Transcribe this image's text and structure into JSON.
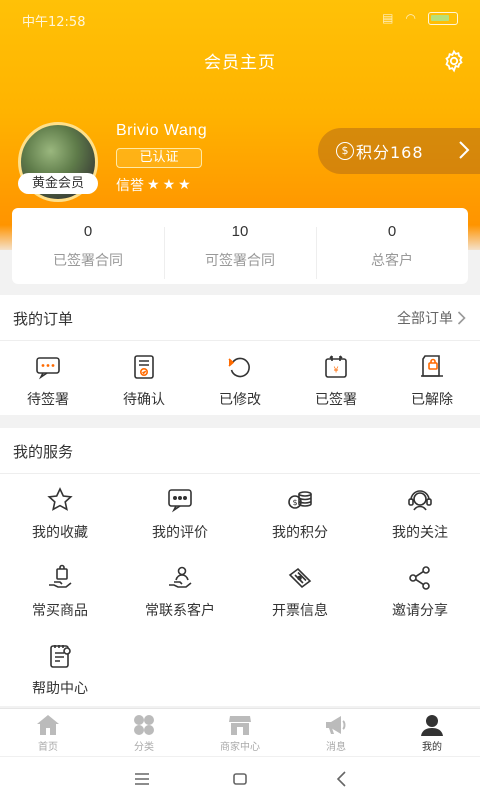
{
  "status_bar": {
    "time": "中午12:58"
  },
  "header": {
    "title": "会员主页"
  },
  "profile": {
    "member_level": "黄金会员",
    "name": "Brivio Wang",
    "verified": "已认证",
    "credit_label": "信誉",
    "credit_stars": 3,
    "points_label": "积分168"
  },
  "stats": [
    {
      "value": "0",
      "label": "已签署合同"
    },
    {
      "value": "10",
      "label": "可签署合同"
    },
    {
      "value": "0",
      "label": "总客户"
    }
  ],
  "orders": {
    "title": "我的订单",
    "all_link": "全部订单",
    "items": [
      {
        "label": "待签署",
        "icon": "chat-dots-icon"
      },
      {
        "label": "待确认",
        "icon": "confirm-doc-icon"
      },
      {
        "label": "已修改",
        "icon": "undo-icon"
      },
      {
        "label": "已签署",
        "icon": "signed-doc-icon"
      },
      {
        "label": "已解除",
        "icon": "terminated-doc-icon"
      }
    ]
  },
  "services": {
    "title": "我的服务",
    "items": [
      {
        "label": "我的收藏",
        "icon": "star-icon"
      },
      {
        "label": "我的评价",
        "icon": "comment-icon"
      },
      {
        "label": "我的积分",
        "icon": "coins-icon"
      },
      {
        "label": "我的关注",
        "icon": "headset-icon"
      },
      {
        "label": "常买商品",
        "icon": "shopping-hand-icon"
      },
      {
        "label": "常联系客户",
        "icon": "contact-hand-icon"
      },
      {
        "label": "开票信息",
        "icon": "invoice-icon"
      },
      {
        "label": "邀请分享",
        "icon": "share-icon"
      },
      {
        "label": "帮助中心",
        "icon": "help-doc-icon"
      }
    ]
  },
  "tabbar": [
    {
      "label": "首页",
      "icon": "home-icon",
      "active": false
    },
    {
      "label": "分类",
      "icon": "category-icon",
      "active": false
    },
    {
      "label": "商家中心",
      "icon": "store-icon",
      "active": false
    },
    {
      "label": "消息",
      "icon": "megaphone-icon",
      "active": false
    },
    {
      "label": "我的",
      "icon": "user-icon",
      "active": true
    }
  ],
  "colors": {
    "accent": "#ffb300",
    "icon_orange": "#ff6a00",
    "text": "#333333"
  }
}
